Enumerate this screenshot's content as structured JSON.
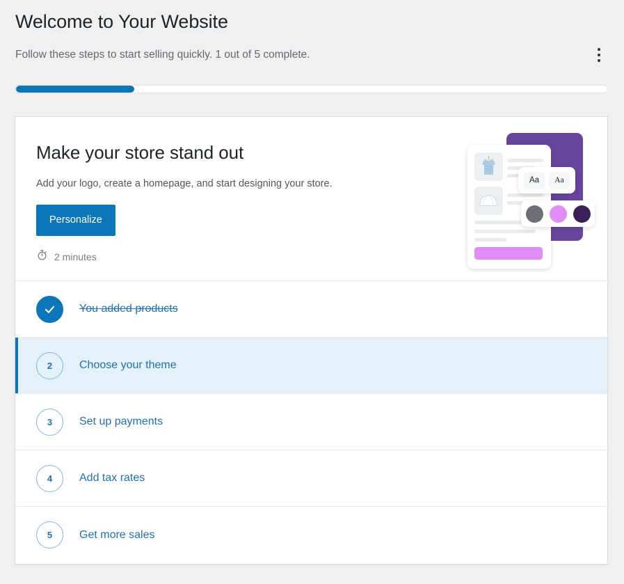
{
  "header": {
    "title": "Welcome to Your Website",
    "subtitle": "Follow these steps to start selling quickly. 1 out of 5 complete.",
    "menu_icon": "kebab-menu-icon"
  },
  "progress": {
    "percent": 20,
    "completed": 1,
    "total": 5,
    "fill_color": "#0b77b8",
    "track_color": "#ffffff"
  },
  "featured_task": {
    "title": "Make your store stand out",
    "description": "Add your logo, create a homepage, and start designing your store.",
    "cta_label": "Personalize",
    "cta_color": "#0b77b8",
    "time_icon": "stopwatch-icon",
    "time_estimate": "2 minutes"
  },
  "illustration": {
    "name": "store-design-illustration",
    "panel_color": "#68459c",
    "accent_color": "#e08ef5",
    "font_samples": [
      "Aa",
      "Aa"
    ],
    "swatches": [
      "#6c7076",
      "#e08ef5",
      "#3a2259"
    ]
  },
  "steps": [
    {
      "number": "1",
      "label": "You added products",
      "state": "done",
      "marker": "check-icon"
    },
    {
      "number": "2",
      "label": "Choose your theme",
      "state": "active",
      "marker": "2"
    },
    {
      "number": "3",
      "label": "Set up payments",
      "state": "pending",
      "marker": "3"
    },
    {
      "number": "4",
      "label": "Add tax rates",
      "state": "pending",
      "marker": "4"
    },
    {
      "number": "5",
      "label": "Get more sales",
      "state": "pending",
      "marker": "5"
    }
  ]
}
